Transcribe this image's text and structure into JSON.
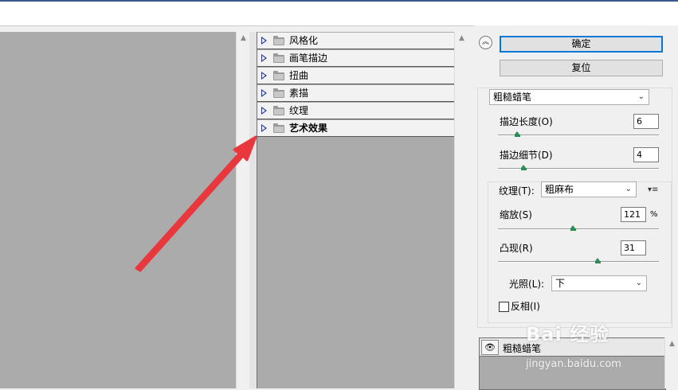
{
  "filter_categories": [
    {
      "label": "风格化",
      "bold": false
    },
    {
      "label": "画笔描边",
      "bold": false
    },
    {
      "label": "扭曲",
      "bold": false
    },
    {
      "label": "素描",
      "bold": false
    },
    {
      "label": "纹理",
      "bold": false
    },
    {
      "label": "艺术效果",
      "bold": true
    }
  ],
  "buttons": {
    "ok": "确定",
    "reset": "复位"
  },
  "filter_select": {
    "value": "粗糙蜡笔"
  },
  "params": {
    "stroke_length": {
      "label": "描边长度(O)",
      "value": "6",
      "level": 0.12
    },
    "stroke_detail": {
      "label": "描边细节(D)",
      "value": "4",
      "level": 0.16
    }
  },
  "texture": {
    "label": "纹理(T):",
    "value": "粗麻布",
    "scaling": {
      "label": "缩放(S)",
      "value": "121",
      "unit": "%",
      "level": 0.47
    },
    "relief": {
      "label": "凸现(R)",
      "value": "31",
      "level": 0.62
    },
    "light": {
      "label": "光照(L):",
      "value": "下"
    },
    "invert": {
      "label": "反相(I)",
      "checked": false
    }
  },
  "layer": {
    "label": "粗糙蜡笔"
  },
  "watermark": {
    "main": "Bai 经验",
    "sub": "jingyan.baidu.com"
  },
  "colors": {
    "accent": "#0078d7",
    "arrow": "#e8383d",
    "canvas": "#ababab"
  },
  "icons": {
    "collapse": "double-chevron-up-icon",
    "eye": "eye-icon",
    "folder": "folder-icon",
    "expand": "triangle-right-icon",
    "menu": "panel-menu-icon"
  }
}
